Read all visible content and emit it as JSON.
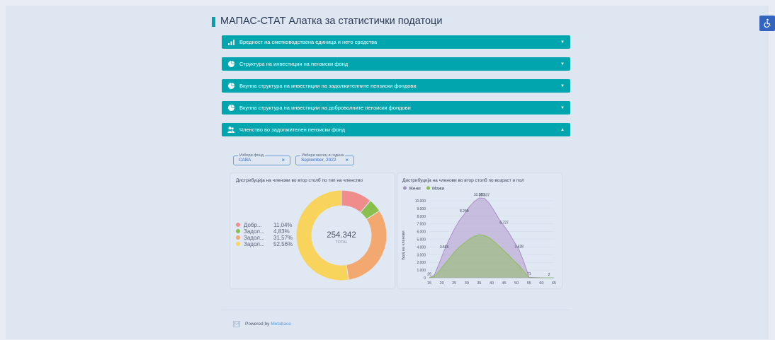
{
  "page": {
    "title": "МАПАС-СТАТ Алатка за статистички податоци",
    "accessibility_icon": "wheelchair-icon"
  },
  "accordions": [
    {
      "label": "Вредност на сметководствена единица и нето средства",
      "icon": "bar-chart-icon",
      "state": "collapsed"
    },
    {
      "label": "Структура на инвестиции на пензиски фонд",
      "icon": "pie-chart-icon",
      "state": "collapsed"
    },
    {
      "label": "Вкупна структура на инвестиции на задолжителните пензиски фондови",
      "icon": "pie-chart-icon",
      "state": "collapsed"
    },
    {
      "label": "Вкупна структура на инвестиции на доброволните пензиски фондови",
      "icon": "pie-chart-icon",
      "state": "collapsed"
    },
    {
      "label": "Членство во задолжителен пензиски фонд",
      "icon": "people-icon",
      "state": "expanded"
    }
  ],
  "filters": {
    "fund": {
      "label": "Избери фонд",
      "value": "САВА"
    },
    "period": {
      "label": "Избери месец и година",
      "value": "September, 2022"
    }
  },
  "chart_data": [
    {
      "type": "pie",
      "title": "Дистрибуција на членови во втор столб по тип на членство",
      "center_value": "254.342",
      "center_label": "TOTAL",
      "slices": [
        {
          "label": "Добр...",
          "percent": 11.04,
          "pct_text": "11,04%",
          "color": "#ef8c8c"
        },
        {
          "label": "Задол...",
          "percent": 4.83,
          "pct_text": "4,83%",
          "color": "#88bf4d"
        },
        {
          "label": "Задол...",
          "percent": 31.57,
          "pct_text": "31,57%",
          "color": "#f2a86f"
        },
        {
          "label": "Задол...",
          "percent": 52.56,
          "pct_text": "52,56%",
          "color": "#f9d45c"
        }
      ]
    },
    {
      "type": "area",
      "title": "Дистрибуција на членови во втор столб по возраст и пол",
      "ylabel": "Број на членови",
      "ylim": [
        0,
        10000
      ],
      "yticks": [
        0,
        1000,
        2000,
        3000,
        4000,
        5000,
        6000,
        7000,
        8000,
        9000,
        10000
      ],
      "ytick_labels": [
        "0",
        "1.000",
        "2.000",
        "3.000",
        "4.000",
        "5.000",
        "6.000",
        "7.000",
        "8.000",
        "9.000",
        "10.000"
      ],
      "xticks": [
        15,
        20,
        25,
        30,
        35,
        40,
        45,
        50,
        55,
        60,
        65
      ],
      "series": [
        {
          "name": "Жени",
          "color": "#a989c5",
          "x": [
            15,
            17,
            19,
            21,
            23,
            25,
            27,
            29,
            31,
            33,
            35,
            37,
            39,
            41,
            43,
            45,
            47,
            49,
            51,
            53,
            55,
            57,
            59,
            61,
            63,
            65
          ],
          "values": [
            29,
            350,
            1900,
            3566,
            5000,
            6300,
            7400,
            8248,
            9200,
            9900,
            10365,
            10337,
            9700,
            8700,
            7600,
            6727,
            5800,
            4700,
            3628,
            2000,
            71,
            40,
            20,
            10,
            2,
            0
          ]
        },
        {
          "name": "Мажи",
          "color": "#88bf4d",
          "x": [
            15,
            17,
            19,
            21,
            23,
            25,
            27,
            29,
            31,
            33,
            35,
            37,
            39,
            41,
            43,
            45,
            47,
            49,
            51,
            53,
            55,
            57,
            59,
            61,
            63,
            65
          ],
          "values": [
            10,
            150,
            900,
            1700,
            2500,
            3300,
            4000,
            4500,
            5000,
            5400,
            5600,
            5500,
            5200,
            4700,
            4100,
            3500,
            2900,
            2200,
            1600,
            800,
            20,
            10,
            5,
            2,
            0,
            0
          ]
        }
      ],
      "annotations": [
        {
          "x": 15,
          "y": 29,
          "text": "29"
        },
        {
          "x": 21,
          "y": 3566,
          "text": "3.566"
        },
        {
          "x": 29,
          "y": 8248,
          "text": "8.248"
        },
        {
          "x": 35,
          "y": 10365,
          "text": "10.365"
        },
        {
          "x": 37,
          "y": 10337,
          "text": "10.337"
        },
        {
          "x": 45,
          "y": 6727,
          "text": "6.727"
        },
        {
          "x": 51,
          "y": 3628,
          "text": "3.628"
        },
        {
          "x": 55,
          "y": 71,
          "text": "71"
        },
        {
          "x": 63,
          "y": 2,
          "text": "2"
        }
      ]
    }
  ],
  "footer": {
    "prefix": "Powered by",
    "brand": "Metabase",
    "logo": "metabase-logo-icon"
  }
}
